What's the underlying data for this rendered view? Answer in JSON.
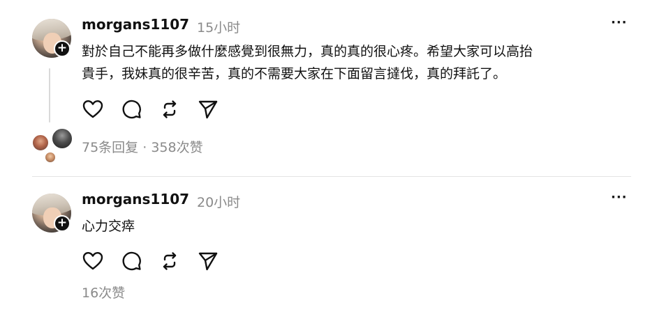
{
  "posts": [
    {
      "username": "morgans1107",
      "time": "15小时",
      "more": "···",
      "lines": [
        "對於自己不能再多做什麼感覺到很無力，真的真的很心疼。希望大家可以高抬",
        "貴手，我妹真的很辛苦，真的不需要大家在下面留言撻伐，真的拜託了。"
      ],
      "replies": "75条回复",
      "separator": " · ",
      "likes": "358次赞"
    },
    {
      "username": "morgans1107",
      "time": "20小时",
      "more": "···",
      "lines": [
        "心力交瘁"
      ],
      "likes": "16次赞"
    }
  ],
  "badge_symbol": "+",
  "icons": {
    "like": "heart-icon",
    "comment": "comment-bubble-icon",
    "repost": "repost-arrows-icon",
    "share": "send-paper-plane-icon"
  },
  "colors": {
    "text": "#111111",
    "muted": "#8a8a8a",
    "divider": "#e3e3e3",
    "thread_line": "#d9d9d9"
  }
}
